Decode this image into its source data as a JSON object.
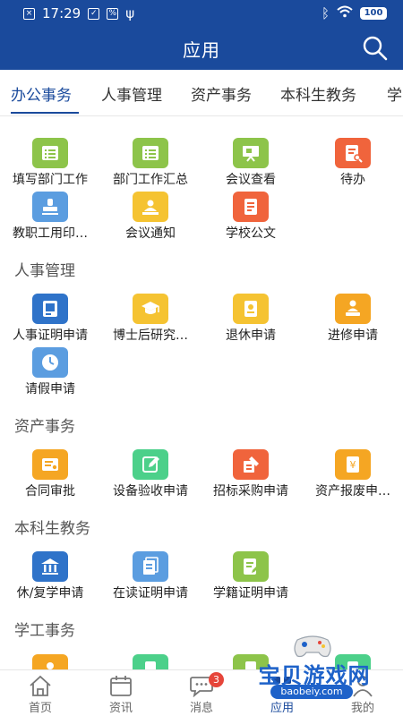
{
  "status_bar": {
    "time": "17:29",
    "battery": "100"
  },
  "header": {
    "title": "应用"
  },
  "tabs": [
    {
      "label": "办公事务"
    },
    {
      "label": "人事管理"
    },
    {
      "label": "资产事务"
    },
    {
      "label": "本科生教务"
    },
    {
      "label": "学"
    }
  ],
  "sections": [
    {
      "items": [
        {
          "label": "填写部门工作",
          "color": "#8dc44a",
          "icon": "list-icon"
        },
        {
          "label": "部门工作汇总",
          "color": "#8dc44a",
          "icon": "list-icon"
        },
        {
          "label": "会议查看",
          "color": "#8dc44a",
          "icon": "presentation-icon"
        },
        {
          "label": "待办",
          "color": "#f0643c",
          "icon": "document-search-icon"
        },
        {
          "label": "教职工用印…",
          "color": "#5b9de0",
          "icon": "stamp-icon"
        },
        {
          "label": "会议通知",
          "color": "#f5c332",
          "icon": "meeting-icon"
        },
        {
          "label": "学校公文",
          "color": "#f0643c",
          "icon": "document-icon"
        }
      ]
    },
    {
      "title": "人事管理",
      "items": [
        {
          "label": "人事证明申请",
          "color": "#2f73c9",
          "icon": "certificate-icon"
        },
        {
          "label": "博士后研究…",
          "color": "#f5c332",
          "icon": "graduation-cap-icon"
        },
        {
          "label": "退休申请",
          "color": "#f5c332",
          "icon": "retire-document-icon"
        },
        {
          "label": "进修申请",
          "color": "#f5a623",
          "icon": "teacher-icon"
        },
        {
          "label": "请假申请",
          "color": "#5b9de0",
          "icon": "clock-person-icon"
        }
      ]
    },
    {
      "title": "资产事务",
      "items": [
        {
          "label": "合同审批",
          "color": "#f5a623",
          "icon": "contract-icon"
        },
        {
          "label": "设备验收申请",
          "color": "#4cd08a",
          "icon": "edit-icon"
        },
        {
          "label": "招标采购申请",
          "color": "#f0643c",
          "icon": "bidding-icon"
        },
        {
          "label": "资产报废申…",
          "color": "#f5a623",
          "icon": "asset-scrap-icon"
        }
      ]
    },
    {
      "title": "本科生教务",
      "items": [
        {
          "label": "休/复学申请",
          "color": "#2f73c9",
          "icon": "school-icon"
        },
        {
          "label": "在读证明申请",
          "color": "#5b9de0",
          "icon": "documents-icon"
        },
        {
          "label": "学籍证明申请",
          "color": "#8dc44a",
          "icon": "certificate-edit-icon"
        }
      ]
    },
    {
      "title": "学工事务",
      "items": [
        {
          "label": "",
          "color": "#f5a623",
          "icon": "person-icon"
        },
        {
          "label": "",
          "color": "#4cd08a",
          "icon": "document-icon"
        },
        {
          "label": "",
          "color": "#8dc44a",
          "icon": "document-icon"
        },
        {
          "label": "",
          "color": "#4cd08a",
          "icon": "document-icon"
        }
      ]
    }
  ],
  "bottom_nav": [
    {
      "label": "首页",
      "icon": "home-icon"
    },
    {
      "label": "资讯",
      "icon": "calendar-icon"
    },
    {
      "label": "消息",
      "icon": "chat-icon",
      "badge": "3"
    },
    {
      "label": "应用",
      "icon": "apps-icon"
    },
    {
      "label": "我的",
      "icon": "person-icon"
    }
  ],
  "watermark": {
    "text": "宝贝游戏网",
    "url": "baobeiy.com"
  },
  "colors": {
    "primary": "#1a4a9c",
    "badge": "#e6453a"
  }
}
